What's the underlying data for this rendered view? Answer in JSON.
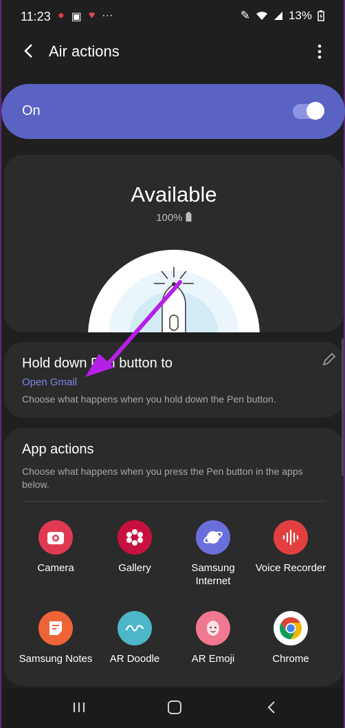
{
  "status_bar": {
    "time": "11:23",
    "battery": "13%"
  },
  "app_bar": {
    "title": "Air actions"
  },
  "master_toggle": {
    "label": "On",
    "state": true,
    "color": "#5a62c4"
  },
  "pen_status": {
    "status": "Available",
    "battery": "100%"
  },
  "hold_action": {
    "title": "Hold down Pen button to",
    "value": "Open Gmail",
    "description": "Choose what happens when you hold down the Pen button."
  },
  "app_actions": {
    "title": "App actions",
    "description": "Choose what happens when you press the Pen button in the apps below.",
    "apps": [
      {
        "label": "Camera",
        "icon": "camera-icon",
        "color": "#e03a52"
      },
      {
        "label": "Gallery",
        "icon": "gallery-icon",
        "color": "#c8103e"
      },
      {
        "label": "Samsung Internet",
        "icon": "samsung-internet-icon",
        "color": "#6b6fdc"
      },
      {
        "label": "Voice Recorder",
        "icon": "voice-recorder-icon",
        "color": "#e24040"
      },
      {
        "label": "Samsung Notes",
        "icon": "samsung-notes-icon",
        "color": "#ee6436"
      },
      {
        "label": "AR Doodle",
        "icon": "ar-doodle-icon",
        "color": "#4db6c8"
      },
      {
        "label": "AR Emoji",
        "icon": "ar-emoji-icon",
        "color": "#f07890"
      },
      {
        "label": "Chrome",
        "icon": "chrome-icon",
        "color": "#ffffff"
      }
    ]
  },
  "annotation": {
    "arrow_color": "#b620e6"
  }
}
